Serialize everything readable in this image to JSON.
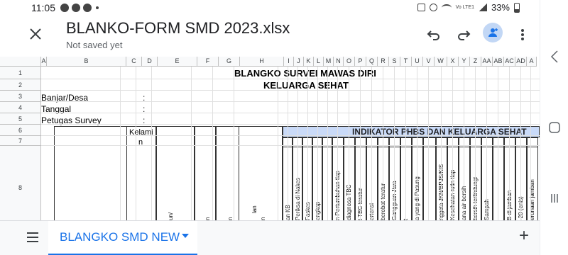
{
  "status_bar": {
    "time": "11:05",
    "battery": "33%",
    "network": "Vo LTE1"
  },
  "toolbar": {
    "title": "BLANKO-FORM SMD 2023.xlsx",
    "subtitle": "Not saved yet",
    "icons": {
      "close": "close-icon",
      "undo": "undo-icon",
      "redo": "redo-icon",
      "share": "add-person-icon",
      "more": "more-vert-icon"
    },
    "accent": "#1a73e8"
  },
  "columns": [
    "A",
    "B",
    "C",
    "D",
    "E",
    "F",
    "G",
    "H",
    "I",
    "J",
    "K",
    "L",
    "M",
    "N",
    "O",
    "P",
    "Q",
    "R",
    "S",
    "T",
    "U",
    "V",
    "W",
    "X",
    "Y",
    "Z",
    "AA",
    "AB",
    "AC",
    "AD",
    "A"
  ],
  "rows": [
    "1",
    "2",
    "3",
    "4",
    "5",
    "6",
    "7",
    "8"
  ],
  "sheet": {
    "title_line1": "BLANGKO SURVEI MAWAS DIRI",
    "title_line2": "KELUARGA SEHAT",
    "labels": [
      "Banjar/Desa",
      "Tanggal",
      "Petugas Survey"
    ],
    "colon": ":",
    "kelamin_line1": "Kelami",
    "kelamin_line2": "n",
    "phbs_header": "INDIKATOR PHBS DAN KELUARGA SEHAT",
    "phbs_color": "#c9daf8",
    "vertical_headers": [
      "an KB",
      "Periksa di Nakes",
      "Faskes",
      "engkap",
      "",
      "n Pertumbuhan tiap",
      "diagnosa TBC",
      "t TBC teratur",
      "ertensi",
      "berobat teratur",
      "Gangguan Jiwa",
      "t",
      "a yang di Pasung",
      "",
      "nggota JKN/BPJS/KIS",
      "Kesehatan rutin tiap",
      "ana air bersih",
      "bersih terlindungi",
      "Sampah",
      "",
      "B di jamban",
      "-20 (enis)",
      "erunaan jamban"
    ],
    "misc_fragments": [
      "un/",
      "n",
      "n",
      "lan",
      "n"
    ]
  },
  "bottom_bar": {
    "sheet_tab": "BLANGKO SMD NEW",
    "menu_icon": "sheet-list-icon",
    "add_icon": "add-sheet-icon",
    "add_label": "+"
  },
  "rail": {
    "icons": [
      "chevron-left-icon",
      "recents-icon",
      "home-icon"
    ]
  }
}
